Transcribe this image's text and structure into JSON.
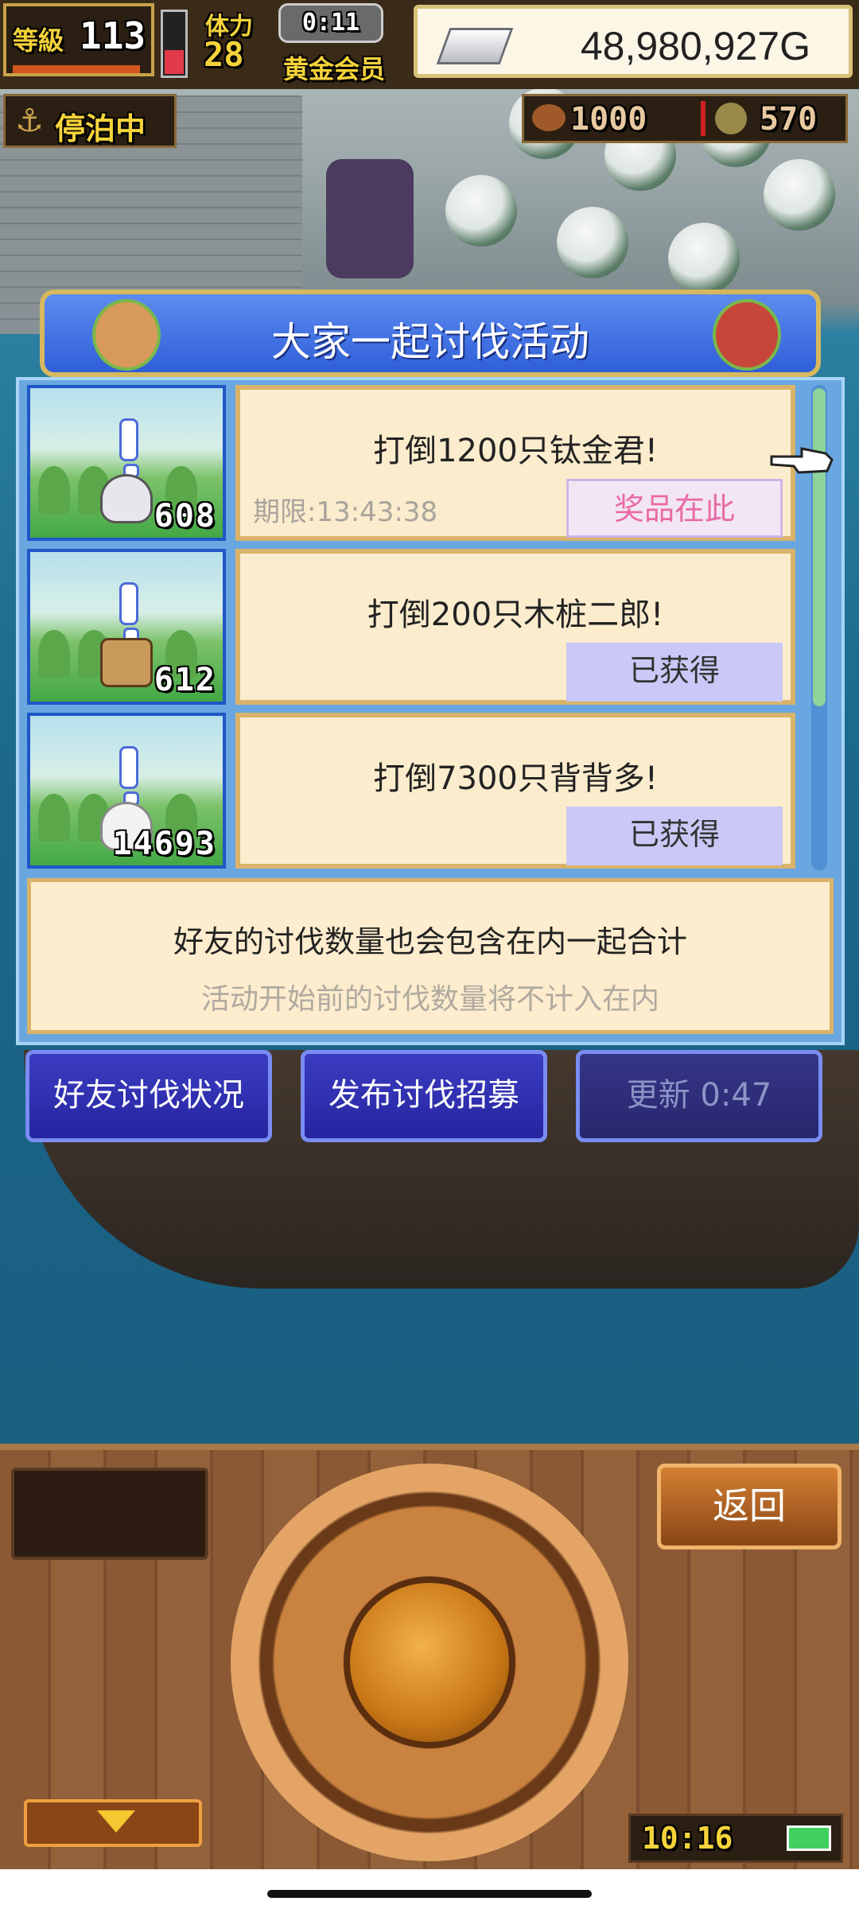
{
  "hud": {
    "level_label": "等級",
    "level": "113",
    "stamina_label": "体力",
    "stamina": "28",
    "timer": "0:11",
    "membership": "黄金会员",
    "money": "48,980,927G",
    "status": "停泊中",
    "resource1": "1000",
    "resource2": "570"
  },
  "event": {
    "title": "大家一起讨伐活动",
    "missions": [
      {
        "count": "608",
        "title": "打倒1200只钛金君!",
        "deadline": "期限:13:43:38",
        "status": "奖品在此"
      },
      {
        "count": "612",
        "title": "打倒200只木桩二郎!",
        "deadline": "",
        "status": "已获得"
      },
      {
        "count": "14693",
        "title": "打倒7300只背背多!",
        "deadline": "",
        "status": "已获得"
      }
    ],
    "note_main": "好友的讨伐数量也会包含在内一起合计",
    "note_sub": "活动开始前的讨伐数量将不计入在内"
  },
  "buttons": {
    "friend_status": "好友讨伐状况",
    "post_recruit": "发布讨伐招募",
    "refresh": "更新 0:47"
  },
  "bottom": {
    "back": "返回",
    "clock": "10:16"
  },
  "colors": {
    "title_bar": "#2f5fd8",
    "card_bg": "#fbeccd",
    "prize_text": "#e86aa4",
    "button_bg": "#2525a0"
  }
}
